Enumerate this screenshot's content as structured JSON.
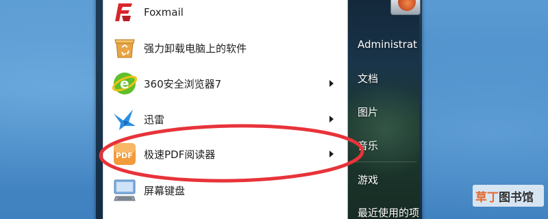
{
  "programs": [
    {
      "label": "Foxmail",
      "icon": "foxmail-icon",
      "has_submenu": false
    },
    {
      "label": "强力卸载电脑上的软件",
      "icon": "uninstall-box-icon",
      "has_submenu": false
    },
    {
      "label": "360安全浏览器7",
      "icon": "360-browser-icon",
      "has_submenu": true
    },
    {
      "label": "迅雷",
      "icon": "xunlei-bird-icon",
      "has_submenu": true
    },
    {
      "label": "极速PDF阅读器",
      "icon": "pdf-reader-icon",
      "has_submenu": true,
      "highlighted": true
    },
    {
      "label": "屏幕键盘",
      "icon": "on-screen-keyboard-icon",
      "has_submenu": false
    }
  ],
  "places": [
    {
      "label": "Administrat"
    },
    {
      "label": "文档"
    },
    {
      "label": "图片"
    },
    {
      "label": "音乐"
    },
    {
      "label": "游戏"
    },
    {
      "label": "最近使用的项"
    }
  ],
  "watermark": {
    "part1": "草丁",
    "part2": "图书馆"
  },
  "colors": {
    "desktop": "#4a8cc8",
    "highlight_ellipse": "#e8333a",
    "menu_white": "#ffffff",
    "places_dark": "#1a3449"
  }
}
